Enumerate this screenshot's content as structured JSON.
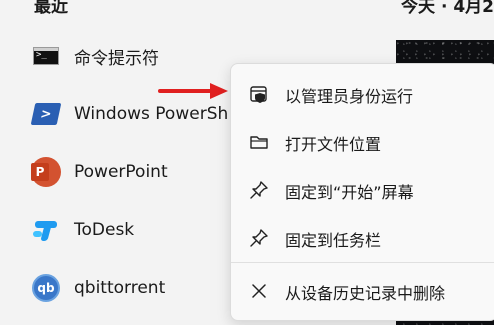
{
  "header": {
    "section_title": "最近",
    "today_label": "今天 · 4月2"
  },
  "apps": [
    {
      "name": "命令提示符",
      "icon": "cmd-icon"
    },
    {
      "name": "Windows PowerSh",
      "icon": "powershell-icon"
    },
    {
      "name": "PowerPoint",
      "icon": "powerpoint-icon",
      "icon_letter": "P"
    },
    {
      "name": "ToDesk",
      "icon": "todesk-icon"
    },
    {
      "name": "qbittorrent",
      "icon": "qbittorrent-icon",
      "icon_letter": "qb"
    }
  ],
  "context_menu": {
    "items": [
      {
        "label": "以管理员身份运行",
        "icon": "admin-shield-icon"
      },
      {
        "label": "打开文件位置",
        "icon": "folder-icon"
      },
      {
        "label": "固定到“开始”屏幕",
        "icon": "pin-icon"
      },
      {
        "label": "固定到任务栏",
        "icon": "pin-icon"
      },
      {
        "label": "从设备历史记录中删除",
        "icon": "close-icon"
      }
    ]
  },
  "colors": {
    "arrow": "#e02020",
    "accent": "#2a5fb3"
  }
}
